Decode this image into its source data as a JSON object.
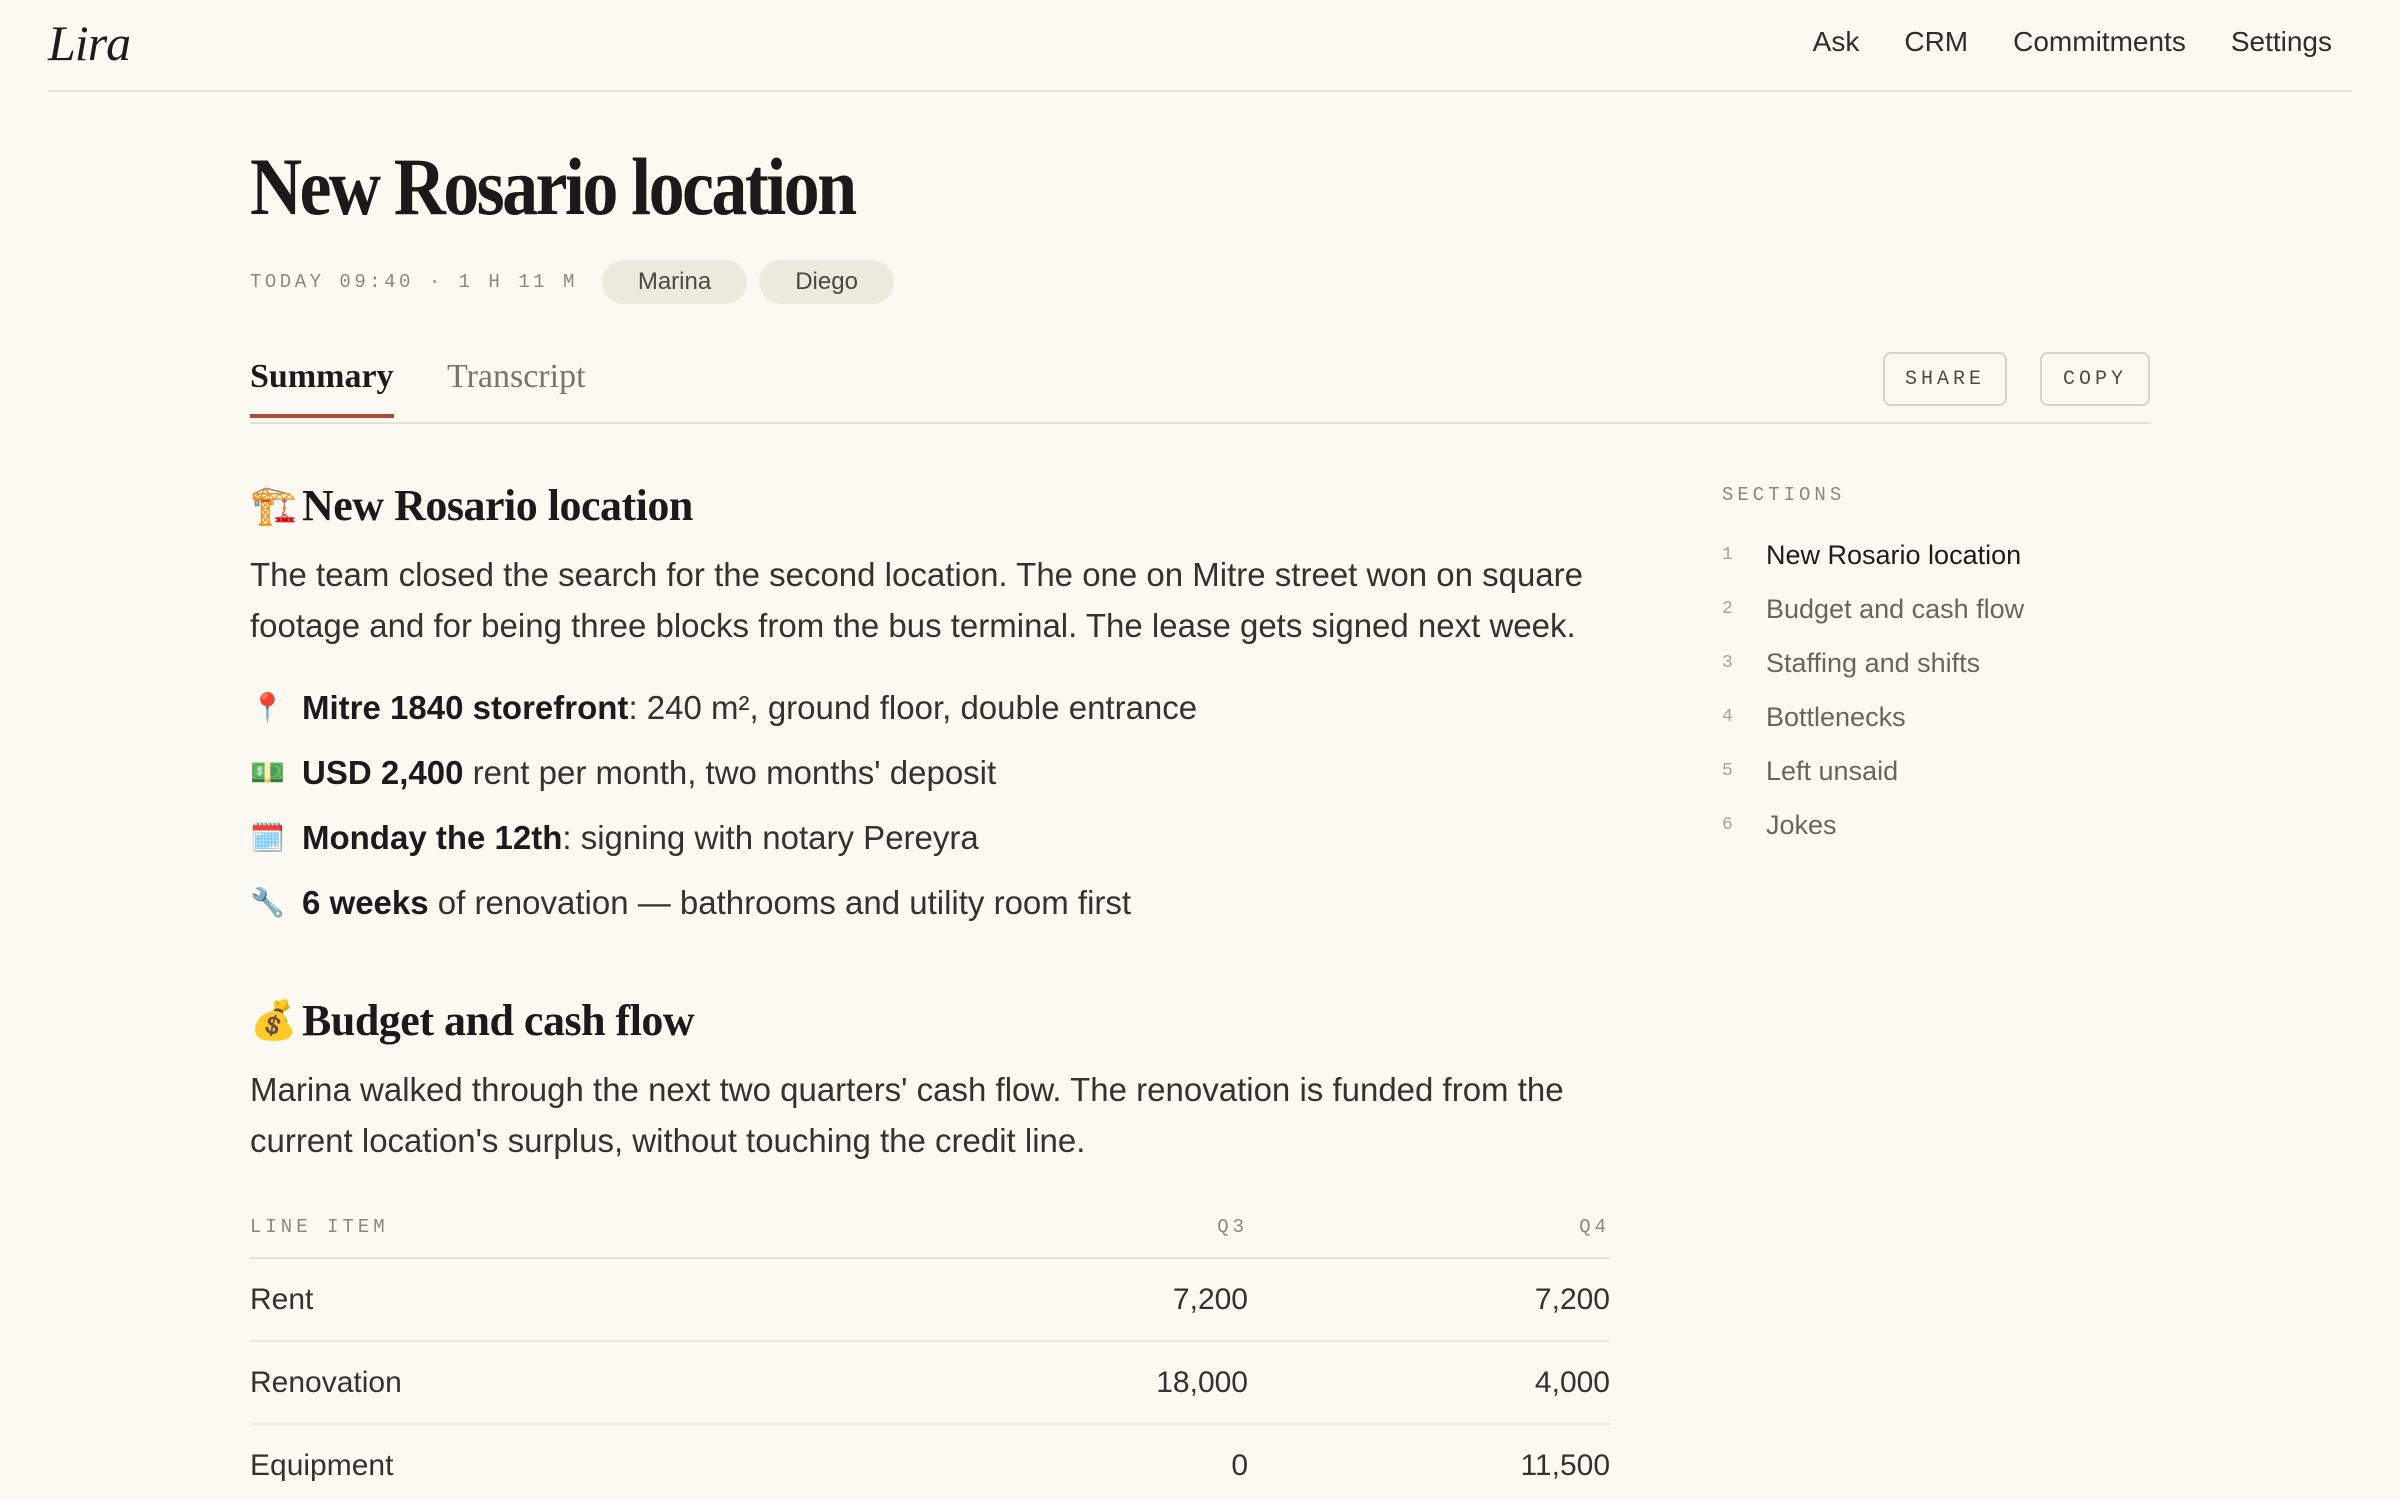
{
  "app": {
    "logo": "Lira",
    "nav": [
      "Ask",
      "CRM",
      "Commitments",
      "Settings"
    ]
  },
  "meeting": {
    "title": "New Rosario location",
    "meta": "TODAY 09:40 · 1 H 11 M",
    "participants": [
      "Marina",
      "Diego"
    ]
  },
  "tabs": {
    "summary": "Summary",
    "transcript": "Transcript",
    "active": "Summary"
  },
  "actions": {
    "share": "SHARE",
    "copy": "COPY"
  },
  "content": {
    "section1": {
      "emoji": "🏗️",
      "heading": "New Rosario location",
      "paragraph": "The team closed the search for the second location. The one on Mitre street won on square footage and for being three blocks from the bus terminal. The lease gets signed next week.",
      "bullets": [
        {
          "emoji": "📍",
          "bold": "Mitre 1840 storefront",
          "rest": ": 240 m², ground floor, double entrance"
        },
        {
          "emoji": "💵",
          "bold": "USD 2,400",
          "rest": " rent per month, two months' deposit"
        },
        {
          "emoji": "🗓️",
          "bold": "Monday the 12th",
          "rest": ": signing with notary Pereyra"
        },
        {
          "emoji": "🔧",
          "bold": "6 weeks",
          "rest": " of renovation — bathrooms and utility room first"
        }
      ]
    },
    "section2": {
      "emoji": "💰",
      "heading": "Budget and cash flow",
      "paragraph": "Marina walked through the next two quarters' cash flow. The renovation is funded from the current location's surplus, without touching the credit line.",
      "table": {
        "headers": [
          "LINE ITEM",
          "Q3",
          "Q4"
        ],
        "rows": [
          [
            "Rent",
            "7,200",
            "7,200"
          ],
          [
            "Renovation",
            "18,000",
            "4,000"
          ],
          [
            "Equipment",
            "0",
            "11,500"
          ]
        ]
      }
    }
  },
  "sidebar": {
    "title": "SECTIONS",
    "items": [
      {
        "num": "1",
        "label": "New Rosario location"
      },
      {
        "num": "2",
        "label": "Budget and cash flow"
      },
      {
        "num": "3",
        "label": "Staffing and shifts"
      },
      {
        "num": "4",
        "label": "Bottlenecks"
      },
      {
        "num": "5",
        "label": "Left unsaid"
      },
      {
        "num": "6",
        "label": "Jokes"
      }
    ],
    "active_index": 0
  },
  "colors": {
    "background": "#fcf9f3",
    "accent": "#a55036",
    "chip": "#eee9df"
  }
}
